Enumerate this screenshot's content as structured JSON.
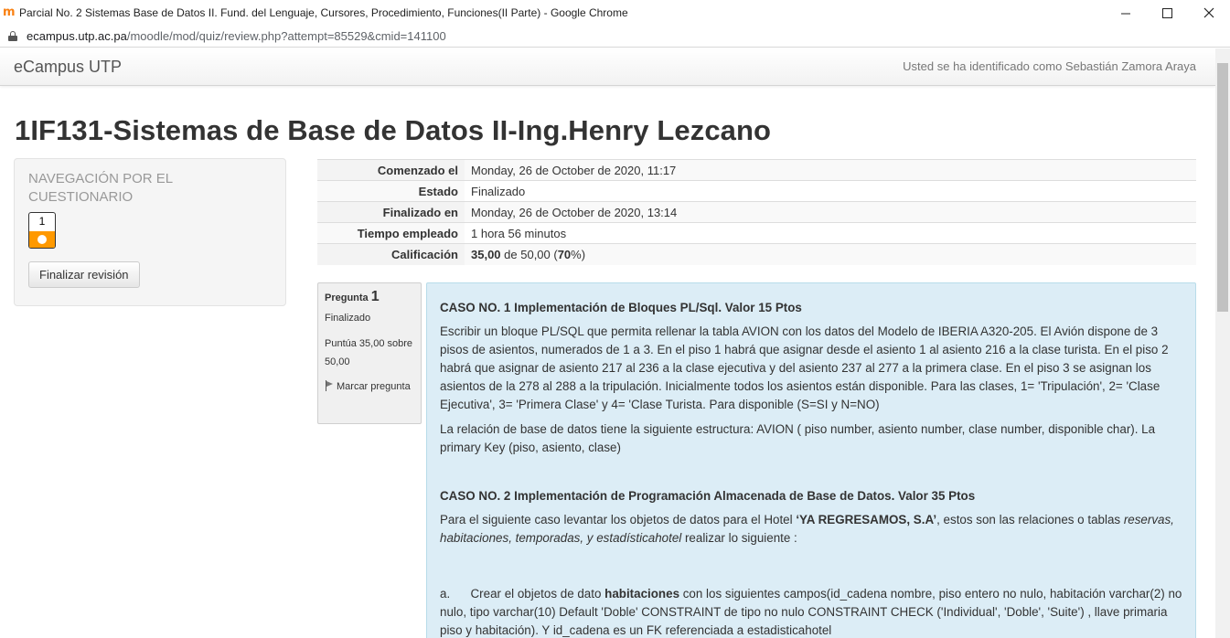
{
  "window": {
    "title": "Parcial No. 2 Sistemas Base de Datos II. Fund. del Lenguaje, Cursores, Procedimiento, Funciones(II Parte) - Google Chrome",
    "favicon": "m"
  },
  "address": {
    "host": "ecampus.utp.ac.pa",
    "path": "/moodle/mod/quiz/review.php?attempt=85529&cmid=141100"
  },
  "navbar": {
    "brand": "eCampus UTP",
    "loggedin": "Usted se ha identificado como Sebastián Zamora Araya"
  },
  "course_title": "1IF131-Sistemas de Base de Datos II-Ing.Henry Lezcano",
  "quiz_nav": {
    "heading": "NAVEGACIÓN POR EL CUESTIONARIO",
    "question_number": "1",
    "finish_label": "Finalizar revisión"
  },
  "summary": {
    "rows": [
      {
        "label": "Comenzado el",
        "value": "Monday, 26 de October de 2020, 11:17"
      },
      {
        "label": "Estado",
        "value": "Finalizado"
      },
      {
        "label": "Finalizado en",
        "value": "Monday, 26 de October de 2020, 13:14"
      },
      {
        "label": "Tiempo empleado",
        "value": "1 hora 56 minutos"
      }
    ],
    "grade_label": "Calificación",
    "grade_score": "35,00",
    "grade_mid": " de 50,00 (",
    "grade_percent": "70",
    "grade_end": "%)"
  },
  "question": {
    "label": "Pregunta",
    "number": "1",
    "state": "Finalizado",
    "score": "Puntúa 35,00 sobre 50,00",
    "flag_label": "Marcar pregunta",
    "caso1_title": "CASO NO. 1 Implementación de Bloques PL/Sql.     Valor  15 Ptos",
    "caso1_p1": "Escribir un bloque PL/SQL que permita rellenar la tabla AVION  con los datos del Modelo de IBERIA  A320-205. El Avión dispone de 3 pisos  de asientos, numerados de 1 a 3. En el piso 1  habrá que asignar desde el asiento 1 al asiento 216 a la clase turista. En el piso 2 habrá que asignar de asiento 217 al 236 a la clase ejecutiva y del asiento 237 al 277 a la primera clase.  En el piso 3 se asignan los asientos de la 278 al 288 a la tripulación. Inicialmente todos los asientos están disponible. Para las clases, 1= 'Tripulación', 2= 'Clase Ejecutiva', 3= 'Primera Clase' y 4= 'Clase Turista. Para disponible (S=SI y  N=NO)",
    "caso1_p2": "La relación  de base de datos tiene la siguiente estructura:  AVION ( piso number, asiento number, clase number, disponible char). La primary Key (piso, asiento, clase)",
    "caso2_title": "CASO NO. 2  Implementación de Programación Almacenada  de Base de Datos.     Valor  35 Ptos",
    "caso2_p1_a": "Para el siguiente caso levantar los objetos de datos para el Hotel ",
    "caso2_p1_hotel": "‘YA REGRESAMOS, S.A’",
    "caso2_p1_b": ", estos son las relaciones o tablas ",
    "caso2_p1_tables": "reservas,  habitaciones, temporadas,  y estadísticahotel",
    "caso2_p1_c": " realizar lo siguiente :",
    "item_a_marker": "a.",
    "item_a_pre": "Crear el objetos de dato ",
    "item_a_bold": "habitaciones",
    "item_a_post": "  con los siguientes campos(id_cadena nombre,  piso entero no nulo, habitación varchar(2) no nulo,  tipo varchar(10) Default 'Doble'   CONSTRAINT  de tipo no nulo CONSTRAINT    CHECK ('Individual', 'Doble', 'Suite') ,  llave primaria  piso y habitación). Y id_cadena es un FK referenciada a  estadisticahotel"
  }
}
